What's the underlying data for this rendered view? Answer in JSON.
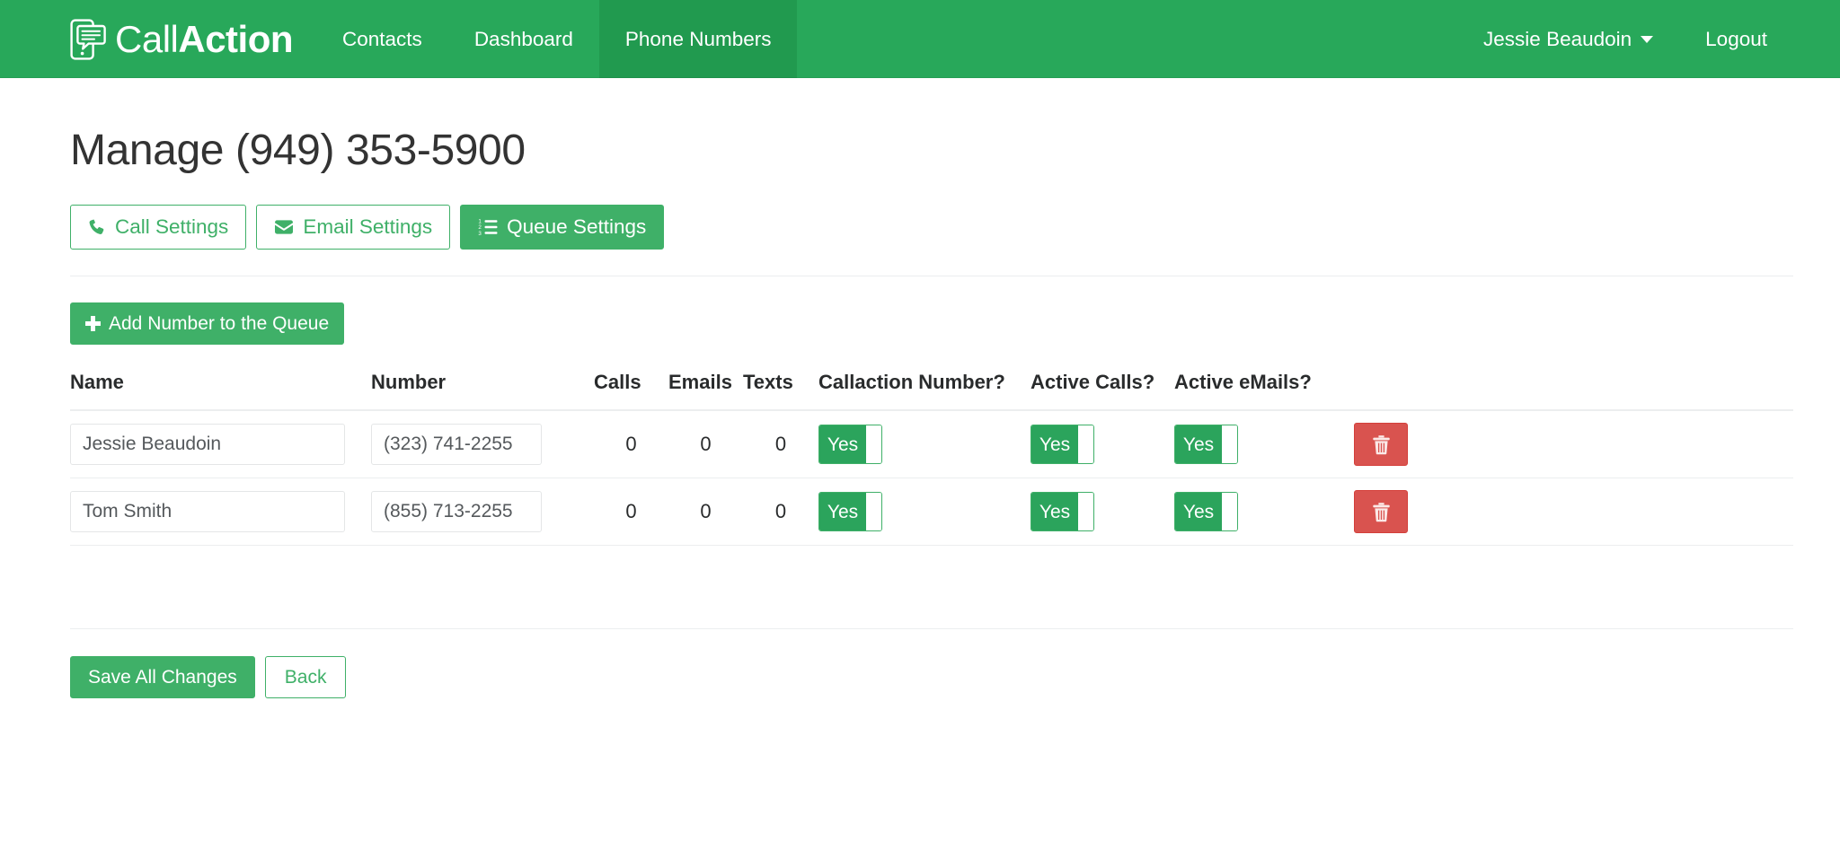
{
  "brand": {
    "name_light": "Call",
    "name_bold": "Action",
    "logo_icon": "phone-chat-icon"
  },
  "navbar": {
    "links": [
      {
        "label": "Contacts",
        "active": false
      },
      {
        "label": "Dashboard",
        "active": false
      },
      {
        "label": "Phone Numbers",
        "active": true
      }
    ],
    "user_name": "Jessie Beaudoin",
    "logout_label": "Logout",
    "background_color": "#28a85a",
    "active_color": "#219a4f"
  },
  "page": {
    "title": "Manage (949) 353-5900"
  },
  "tabs": [
    {
      "label": "Call Settings",
      "icon": "phone-icon",
      "active": false
    },
    {
      "label": "Email Settings",
      "icon": "envelope-icon",
      "active": false
    },
    {
      "label": "Queue Settings",
      "icon": "ordered-list-icon",
      "active": true
    }
  ],
  "toolbar": {
    "add_label": "Add Number to the Queue",
    "add_icon": "plus-icon"
  },
  "table": {
    "headers": {
      "name": "Name",
      "number": "Number",
      "calls": "Calls",
      "emails": "Emails",
      "texts": "Texts",
      "callaction_number": "Callaction Number?",
      "active_calls": "Active Calls?",
      "active_emails": "Active eMails?"
    },
    "rows": [
      {
        "name": "Jessie Beaudoin",
        "number": "(323) 741-2255",
        "calls": "0",
        "emails": "0",
        "texts": "0",
        "callaction_number": "Yes",
        "active_calls": "Yes",
        "active_emails": "Yes",
        "delete_icon": "trash-icon"
      },
      {
        "name": "Tom Smith",
        "number": "(855) 713-2255",
        "calls": "0",
        "emails": "0",
        "texts": "0",
        "callaction_number": "Yes",
        "active_calls": "Yes",
        "active_emails": "Yes",
        "delete_icon": "trash-icon"
      }
    ]
  },
  "footer": {
    "save_label": "Save All Changes",
    "back_label": "Back"
  },
  "colors": {
    "brand_green": "#28a85a",
    "button_green": "#3fb068",
    "toggle_green": "#2ba45c",
    "danger_red": "#d9534f",
    "text_dark": "#292b2c",
    "border_light": "#eceeef"
  }
}
